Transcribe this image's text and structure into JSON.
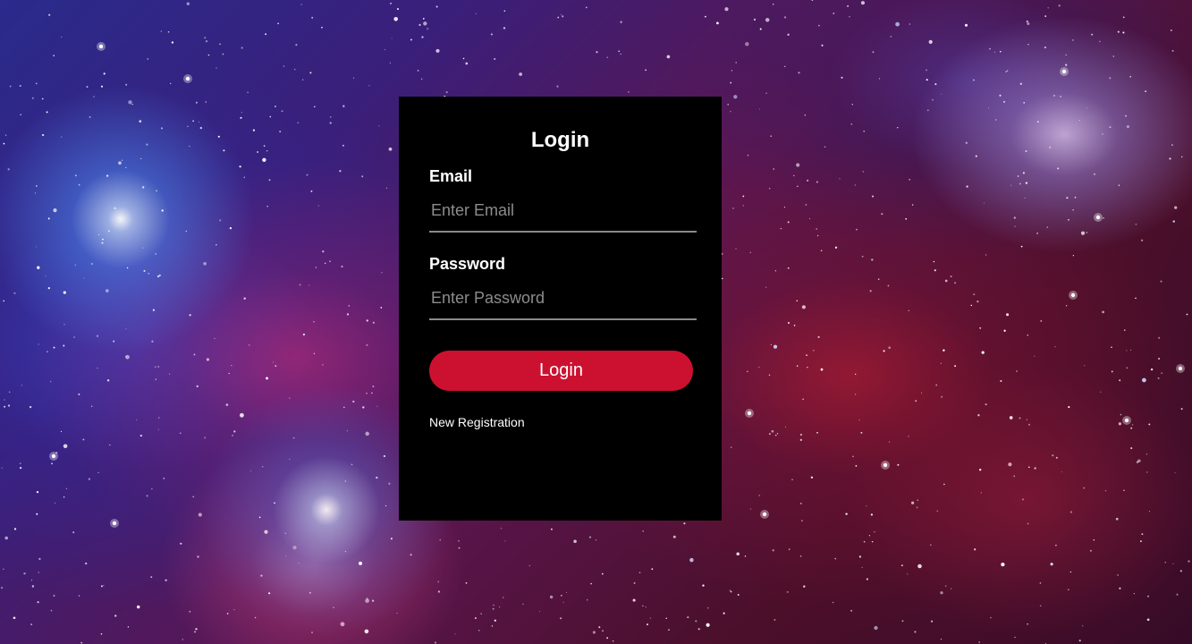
{
  "background": {
    "description_icon": "galaxy-nebula-background"
  },
  "colors": {
    "card_background": "#000000",
    "accent": "#cc1130",
    "text": "#ffffff",
    "placeholder": "#8c8c8c",
    "underline": "#8a8a8a"
  },
  "login_form": {
    "title": "Login",
    "email": {
      "label": "Email",
      "placeholder": "Enter Email",
      "value": ""
    },
    "password": {
      "label": "Password",
      "placeholder": "Enter Password",
      "value": ""
    },
    "submit_label": "Login",
    "register_link": "New Registration"
  }
}
